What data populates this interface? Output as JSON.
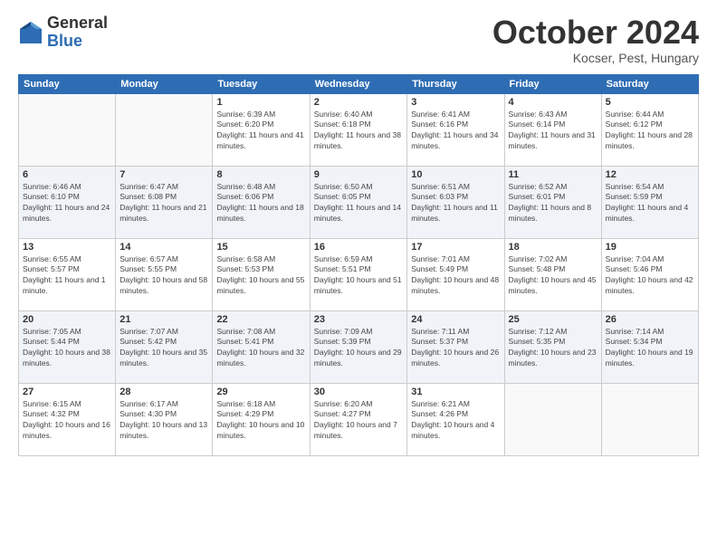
{
  "logo": {
    "general": "General",
    "blue": "Blue"
  },
  "header": {
    "title": "October 2024",
    "subtitle": "Kocser, Pest, Hungary"
  },
  "weekdays": [
    "Sunday",
    "Monday",
    "Tuesday",
    "Wednesday",
    "Thursday",
    "Friday",
    "Saturday"
  ],
  "weeks": [
    [
      null,
      null,
      {
        "day": 1,
        "sunrise": "6:39 AM",
        "sunset": "6:20 PM",
        "daylight": "11 hours and 41 minutes."
      },
      {
        "day": 2,
        "sunrise": "6:40 AM",
        "sunset": "6:18 PM",
        "daylight": "11 hours and 38 minutes."
      },
      {
        "day": 3,
        "sunrise": "6:41 AM",
        "sunset": "6:16 PM",
        "daylight": "11 hours and 34 minutes."
      },
      {
        "day": 4,
        "sunrise": "6:43 AM",
        "sunset": "6:14 PM",
        "daylight": "11 hours and 31 minutes."
      },
      {
        "day": 5,
        "sunrise": "6:44 AM",
        "sunset": "6:12 PM",
        "daylight": "11 hours and 28 minutes."
      }
    ],
    [
      {
        "day": 6,
        "sunrise": "6:46 AM",
        "sunset": "6:10 PM",
        "daylight": "11 hours and 24 minutes."
      },
      {
        "day": 7,
        "sunrise": "6:47 AM",
        "sunset": "6:08 PM",
        "daylight": "11 hours and 21 minutes."
      },
      {
        "day": 8,
        "sunrise": "6:48 AM",
        "sunset": "6:06 PM",
        "daylight": "11 hours and 18 minutes."
      },
      {
        "day": 9,
        "sunrise": "6:50 AM",
        "sunset": "6:05 PM",
        "daylight": "11 hours and 14 minutes."
      },
      {
        "day": 10,
        "sunrise": "6:51 AM",
        "sunset": "6:03 PM",
        "daylight": "11 hours and 11 minutes."
      },
      {
        "day": 11,
        "sunrise": "6:52 AM",
        "sunset": "6:01 PM",
        "daylight": "11 hours and 8 minutes."
      },
      {
        "day": 12,
        "sunrise": "6:54 AM",
        "sunset": "5:59 PM",
        "daylight": "11 hours and 4 minutes."
      }
    ],
    [
      {
        "day": 13,
        "sunrise": "6:55 AM",
        "sunset": "5:57 PM",
        "daylight": "11 hours and 1 minute."
      },
      {
        "day": 14,
        "sunrise": "6:57 AM",
        "sunset": "5:55 PM",
        "daylight": "10 hours and 58 minutes."
      },
      {
        "day": 15,
        "sunrise": "6:58 AM",
        "sunset": "5:53 PM",
        "daylight": "10 hours and 55 minutes."
      },
      {
        "day": 16,
        "sunrise": "6:59 AM",
        "sunset": "5:51 PM",
        "daylight": "10 hours and 51 minutes."
      },
      {
        "day": 17,
        "sunrise": "7:01 AM",
        "sunset": "5:49 PM",
        "daylight": "10 hours and 48 minutes."
      },
      {
        "day": 18,
        "sunrise": "7:02 AM",
        "sunset": "5:48 PM",
        "daylight": "10 hours and 45 minutes."
      },
      {
        "day": 19,
        "sunrise": "7:04 AM",
        "sunset": "5:46 PM",
        "daylight": "10 hours and 42 minutes."
      }
    ],
    [
      {
        "day": 20,
        "sunrise": "7:05 AM",
        "sunset": "5:44 PM",
        "daylight": "10 hours and 38 minutes."
      },
      {
        "day": 21,
        "sunrise": "7:07 AM",
        "sunset": "5:42 PM",
        "daylight": "10 hours and 35 minutes."
      },
      {
        "day": 22,
        "sunrise": "7:08 AM",
        "sunset": "5:41 PM",
        "daylight": "10 hours and 32 minutes."
      },
      {
        "day": 23,
        "sunrise": "7:09 AM",
        "sunset": "5:39 PM",
        "daylight": "10 hours and 29 minutes."
      },
      {
        "day": 24,
        "sunrise": "7:11 AM",
        "sunset": "5:37 PM",
        "daylight": "10 hours and 26 minutes."
      },
      {
        "day": 25,
        "sunrise": "7:12 AM",
        "sunset": "5:35 PM",
        "daylight": "10 hours and 23 minutes."
      },
      {
        "day": 26,
        "sunrise": "7:14 AM",
        "sunset": "5:34 PM",
        "daylight": "10 hours and 19 minutes."
      }
    ],
    [
      {
        "day": 27,
        "sunrise": "6:15 AM",
        "sunset": "4:32 PM",
        "daylight": "10 hours and 16 minutes."
      },
      {
        "day": 28,
        "sunrise": "6:17 AM",
        "sunset": "4:30 PM",
        "daylight": "10 hours and 13 minutes."
      },
      {
        "day": 29,
        "sunrise": "6:18 AM",
        "sunset": "4:29 PM",
        "daylight": "10 hours and 10 minutes."
      },
      {
        "day": 30,
        "sunrise": "6:20 AM",
        "sunset": "4:27 PM",
        "daylight": "10 hours and 7 minutes."
      },
      {
        "day": 31,
        "sunrise": "6:21 AM",
        "sunset": "4:26 PM",
        "daylight": "10 hours and 4 minutes."
      },
      null,
      null
    ]
  ]
}
